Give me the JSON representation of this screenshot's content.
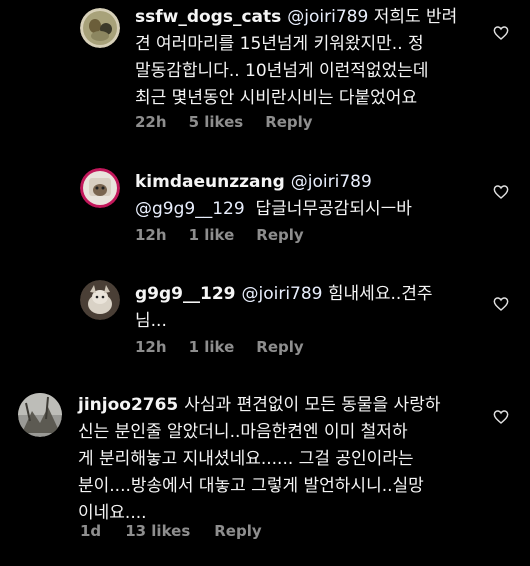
{
  "comments": [
    {
      "username": "ssfw_dogs_cats",
      "mention": "@joiri789",
      "lines": [
        "저희도 반려",
        "견 여러마리를 15년넘게 키워왔지만.. 정",
        "말동감합니다.. 10년넘게 이런적없었는데",
        "최근 몇년동안 시비란시비는 다붙었어요"
      ],
      "time": "22h",
      "likes": "5 likes",
      "reply": "Reply"
    },
    {
      "username": "kimdaeunzzang",
      "mention": "@joiri789",
      "mention2": "@g9g9__129",
      "lines": [
        "",
        "답글너무공감되시ㅡ바"
      ],
      "time": "12h",
      "likes": "1 like",
      "reply": "Reply"
    },
    {
      "username": "g9g9__129",
      "mention": "@joiri789",
      "lines": [
        "힘내세요..견주",
        "님..."
      ],
      "time": "12h",
      "likes": "1 like",
      "reply": "Reply"
    },
    {
      "username": "jinjoo2765",
      "lines": [
        "사심과 편견없이 모든 동물을 사랑하",
        "신는 분인줄 알았더니..마음한켠엔 이미  철저하",
        "게 분리해놓고 지내셨네요...... 그걸 공인이라는",
        "분이....방송에서 대놓고 그렇게 발언하시니..실망",
        "이네요...."
      ],
      "time": "1d",
      "likes": "13 likes",
      "reply": "Reply"
    }
  ],
  "icons": {
    "heart": "heart-outline-icon"
  },
  "colors": {
    "background": "#000000",
    "text": "#f5f5f5",
    "meta": "#8e8e8e"
  }
}
